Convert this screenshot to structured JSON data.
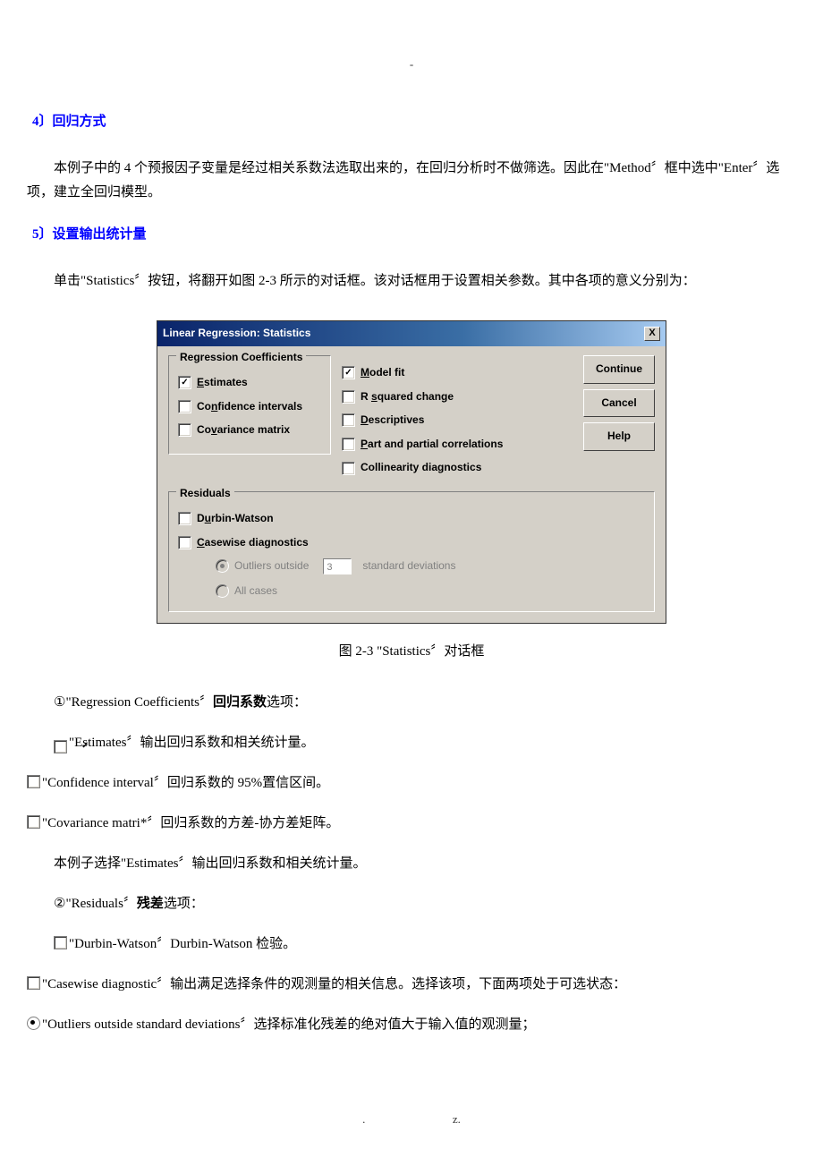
{
  "topDash": "-",
  "sec4": {
    "heading": "4〕回归方式",
    "para": "本例子中的 4 个预报因子变量是经过相关系数法选取出来的，在回归分析时不做筛选。因此在\"Method〞框中选中\"Enter〞选项，建立全回归模型。"
  },
  "sec5": {
    "heading": "5〕设置输出统计量",
    "para": "单击\"Statistics〞按钮，将翻开如图 2-3 所示的对话框。该对话框用于设置相关参数。其中各项的意义分别为："
  },
  "dialog": {
    "title": "Linear Regression: Statistics",
    "groups": {
      "regression": {
        "legend": "Regression Coefficients",
        "estimates": "Estimates",
        "confidence": "Confidence intervals",
        "covariance": "Covariance matrix"
      },
      "middle": {
        "modelFit": "Model fit",
        "rsquared": "R squared change",
        "descriptives": "Descriptives",
        "partpartial": "Part and partial correlations",
        "collinearity": "Collinearity diagnostics"
      },
      "residuals": {
        "legend": "Residuals",
        "durbin": "Durbin-Watson",
        "casewise": "Casewise diagnostics",
        "outliers": "Outliers outside",
        "stdDev": "standard deviations",
        "outliersValue": "3",
        "allcases": "All cases"
      }
    },
    "buttons": {
      "continue": "Continue",
      "cancel": "Cancel",
      "help": "Help"
    }
  },
  "caption": "图 2-3 \"Statistics〞对话框",
  "item1": {
    "heading": "①\"Regression Coefficients〞回归系数选项：",
    "heading_plain": "选项：",
    "heading_bold": "回归系数",
    "heading_prefix": "①\"Regression Coefficients〞",
    "estimates": "\"Estimates〞输出回归系数和相关统计量。",
    "confidence": "\"Confidence interval〞回归系数的 95%置信区间。",
    "covariance": "\"Covariance matri*〞回归系数的方差-协方差矩阵。",
    "summary": "本例子选择\"Estimates〞输出回归系数和相关统计量。"
  },
  "item2": {
    "heading_prefix": "②\"Residuals〞",
    "heading_bold": "残差",
    "heading_plain": "选项：",
    "durbin": "\"Durbin-Watson〞Durbin-Watson 检验。",
    "casewise": "\"Casewise diagnostic〞输出满足选择条件的观测量的相关信息。选择该项，下面两项处于可选状态：",
    "outliers": "\"Outliers outside standard deviations〞选择标准化残差的绝对值大于输入值的观测量；"
  },
  "footer": {
    "dot": ".",
    "z": "z."
  }
}
